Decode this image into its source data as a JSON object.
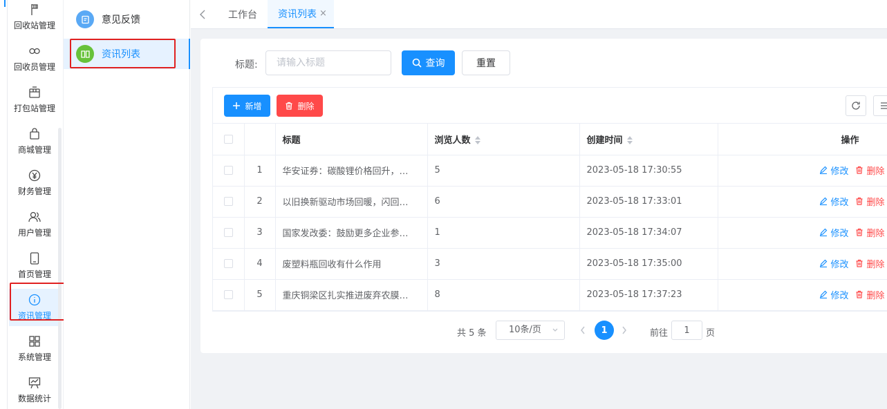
{
  "rail": {
    "items": [
      {
        "label": "回收站管理",
        "icon": "flag-icon"
      },
      {
        "label": "回收员管理",
        "icon": "infinity-icon"
      },
      {
        "label": "打包站管理",
        "icon": "box-icon"
      },
      {
        "label": "商城管理",
        "icon": "bag-icon"
      },
      {
        "label": "财务管理",
        "icon": "yen-icon"
      },
      {
        "label": "用户管理",
        "icon": "users-icon"
      },
      {
        "label": "首页管理",
        "icon": "tablet-icon"
      },
      {
        "label": "资讯管理",
        "icon": "info-icon"
      },
      {
        "label": "系统管理",
        "icon": "grid-icon"
      },
      {
        "label": "数据统计",
        "icon": "chart-board-icon"
      }
    ],
    "active_index": 7
  },
  "submenu": {
    "items": [
      {
        "label": "意见反馈",
        "icon": "feedback-icon",
        "color": "#5aa9f5"
      },
      {
        "label": "资讯列表",
        "icon": "book-icon",
        "color": "#67c23a"
      }
    ],
    "active_index": 1
  },
  "tabs": {
    "items": [
      {
        "label": "工作台"
      },
      {
        "label": "资讯列表",
        "closable": true
      }
    ],
    "active_index": 1,
    "close_glyph": "×"
  },
  "search": {
    "label": "标题:",
    "placeholder": "请输入标题",
    "value": "",
    "query_label": "查询",
    "reset_label": "重置"
  },
  "toolbar": {
    "add_label": "新增",
    "delete_label": "删除"
  },
  "table": {
    "columns": [
      "",
      "",
      "标题",
      "浏览人数",
      "创建时间",
      "操作"
    ],
    "rows": [
      {
        "index": "1",
        "title": "华安证券：碳酸锂价格回升，…",
        "views": "5",
        "created": "2023-05-18 17:30:55"
      },
      {
        "index": "2",
        "title": "以旧换新驱动市场回暖，闪回…",
        "views": "6",
        "created": "2023-05-18 17:33:01"
      },
      {
        "index": "3",
        "title": "国家发改委：鼓励更多企业参…",
        "views": "1",
        "created": "2023-05-18 17:34:07"
      },
      {
        "index": "4",
        "title": "废塑料瓶回收有什么作用",
        "views": "3",
        "created": "2023-05-18 17:35:00"
      },
      {
        "index": "5",
        "title": "重庆铜梁区扎实推进废弃农膜…",
        "views": "8",
        "created": "2023-05-18 17:37:23"
      }
    ],
    "edit_label": "修改",
    "delete_label": "删除"
  },
  "pagination": {
    "total": "共 5 条",
    "page_size": "10条/页",
    "current_page": "1",
    "goto_label": "前往",
    "goto_value": "1",
    "page_unit": "页"
  },
  "colors": {
    "primary": "#1890ff",
    "danger": "#ff4949",
    "highlight_box": "#e02020"
  }
}
